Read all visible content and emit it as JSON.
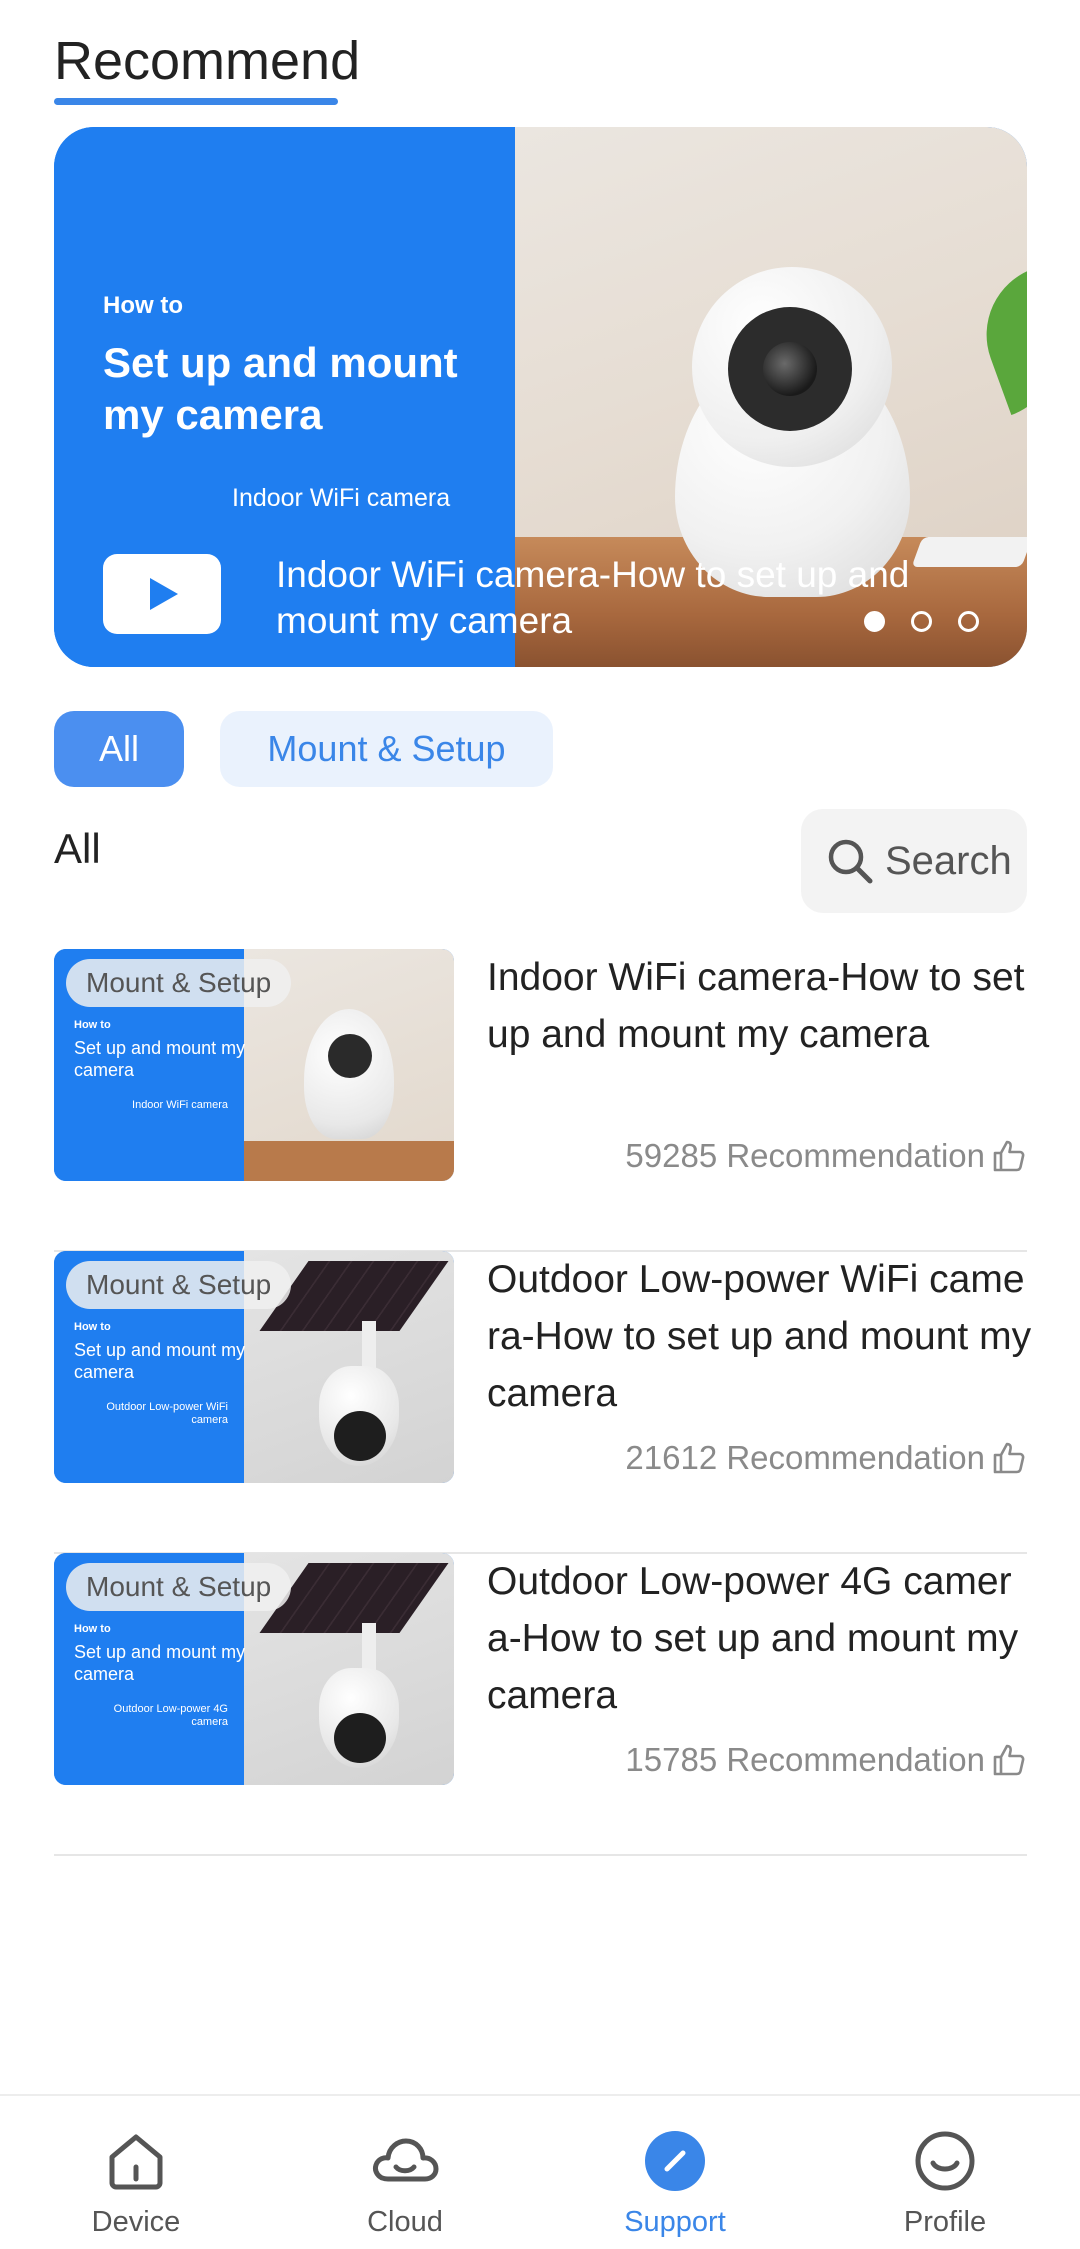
{
  "header": {
    "title": "Recommend"
  },
  "banner": {
    "how_to": "How to",
    "heading_line1": "Set up and mount",
    "heading_line2": "my camera",
    "product": "Indoor WiFi camera",
    "caption": "Indoor WiFi camera-How to set up and mount my camera",
    "dots": {
      "count": 3,
      "active_index": 0
    }
  },
  "filters": {
    "all_label": "All",
    "mount_label": "Mount & Setup",
    "selected": "All"
  },
  "section": {
    "label": "All"
  },
  "search": {
    "label": "Search",
    "icon": "search-icon"
  },
  "articles": [
    {
      "tag": "Mount & Setup",
      "thumb_howto": "How to",
      "thumb_heading": "Set up and mount my camera",
      "thumb_product": "Indoor WiFi camera",
      "title": "Indoor WiFi camera-How to set up and mount my camera",
      "count": "59285 Recommendation"
    },
    {
      "tag": "Mount & Setup",
      "thumb_howto": "How to",
      "thumb_heading": "Set up and mount my camera",
      "thumb_product": "Outdoor Low-power WiFi camera",
      "title": "Outdoor Low-power WiFi camera-How to set up and mount my camera",
      "count": "21612 Recommendation"
    },
    {
      "tag": "Mount & Setup",
      "thumb_howto": "How to",
      "thumb_heading": "Set up and mount my camera",
      "thumb_product": "Outdoor Low-power 4G camera",
      "title": "Outdoor Low-power 4G camera-How to set up and mount my camera",
      "count": "15785 Recommendation"
    }
  ],
  "nav": {
    "items": [
      {
        "label": "Device",
        "icon": "house-icon"
      },
      {
        "label": "Cloud",
        "icon": "cloud-icon"
      },
      {
        "label": "Support",
        "icon": "compass-icon"
      },
      {
        "label": "Profile",
        "icon": "smiley-icon"
      }
    ],
    "active": "Support"
  },
  "colors": {
    "accent": "#3a86e8",
    "banner_blue": "#1f7ef0",
    "chip_active": "#4b8ff0",
    "chip_inactive_bg": "#eaf2fd"
  }
}
